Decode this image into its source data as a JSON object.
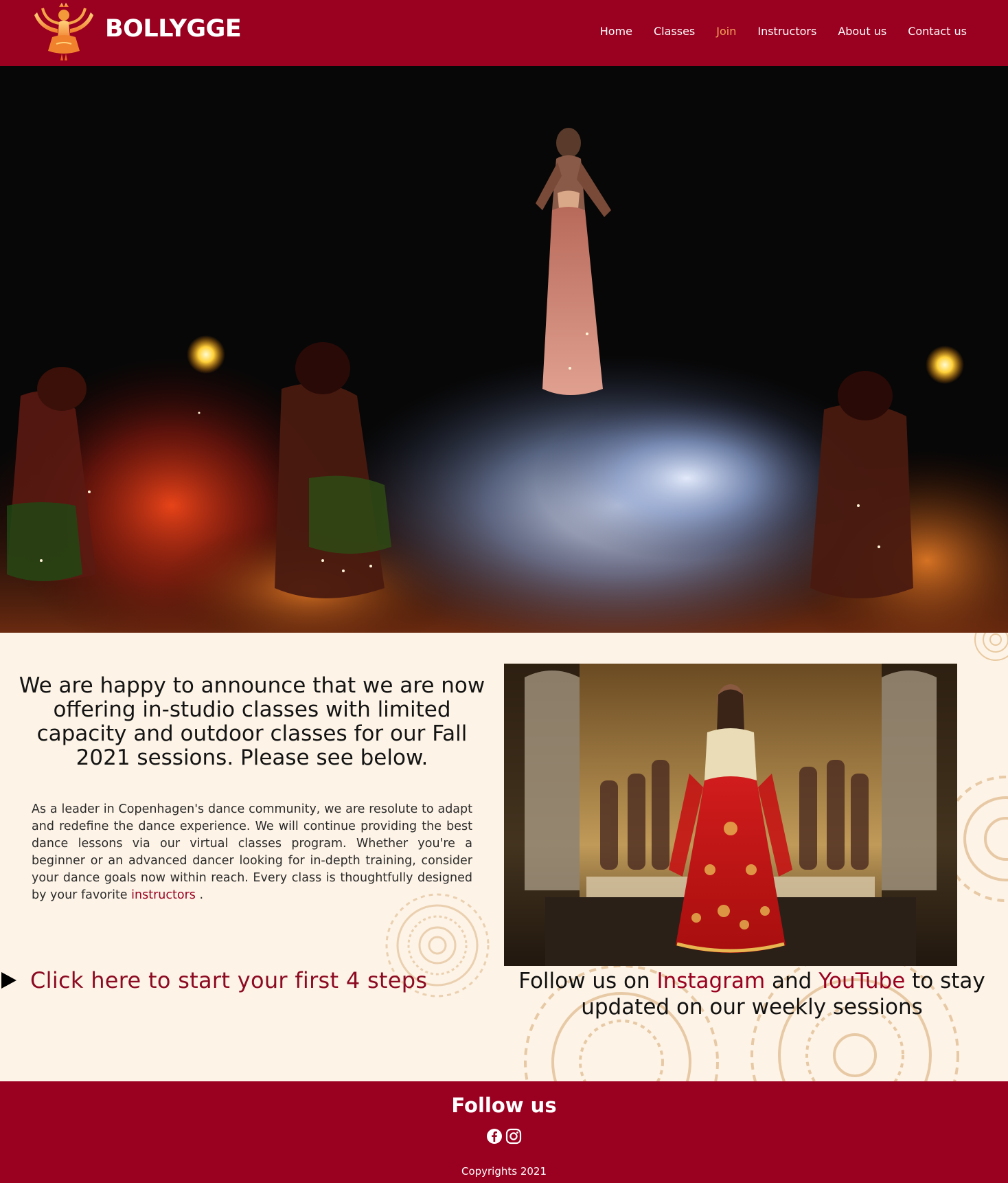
{
  "header": {
    "brand": "BOLLYGGE",
    "logo_icon": "dancer-logo-icon",
    "nav": [
      {
        "label": "Home",
        "active": false
      },
      {
        "label": "Classes",
        "active": false
      },
      {
        "label": "Join",
        "active": true
      },
      {
        "label": "Instructors",
        "active": false
      },
      {
        "label": "About us",
        "active": false
      },
      {
        "label": "Contact us",
        "active": false
      }
    ]
  },
  "main": {
    "headline": "We are happy to announce that we are now offering in-studio classes with limited capacity and outdoor classes for our Fall 2021 sessions. Please see below.",
    "intro_text": "As a leader in Copenhagen's dance community, we are resolute to adapt and redefine the dance experience. We will continue providing the best dance lessons via our virtual classes program. Whether you're a beginner or an advanced dancer looking for in-depth training, consider your dance goals now within reach. Every class is thoughtfully designed by your favorite",
    "intro_link": "instructors",
    "intro_end": " .",
    "cta": "Click here to start your first 4 steps",
    "follow_prefix": "Follow us on ",
    "follow_instagram": "Instagram",
    "follow_and": " and ",
    "follow_youtube": "YouTube",
    "follow_suffix": " to stay updated on our weekly sessions"
  },
  "footer": {
    "title": "Follow us",
    "icons": [
      "facebook-icon",
      "instagram-icon"
    ],
    "copyright": "Copyrights 2021"
  },
  "colors": {
    "primary": "#9a0020",
    "active_nav": "#f5a55a",
    "background": "#fdf3e6",
    "cta_text": "#8c0a22"
  }
}
